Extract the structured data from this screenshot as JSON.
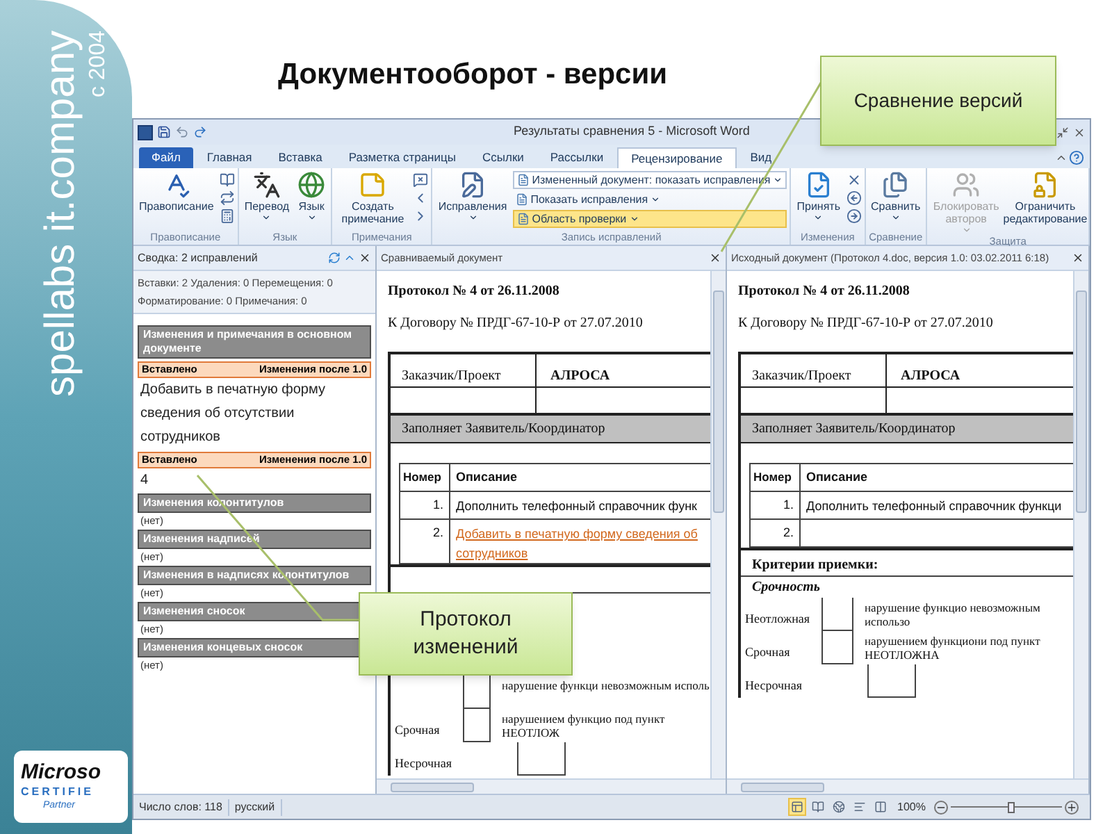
{
  "brand": {
    "name": "spellabs it.company",
    "since": "с 2004"
  },
  "partner_logo": {
    "brand": "Microso",
    "line": "CERTIFIE",
    "tier": "Partner"
  },
  "slide_title": "Документооборот - версии",
  "callouts": [
    {
      "text": "Сравнение версий"
    },
    {
      "text": "Протокол изменений"
    }
  ],
  "window": {
    "title": "Результаты сравнения 5 - Microsoft Word"
  },
  "tabs": [
    {
      "label": "Файл",
      "kind": "file",
      "selected": false
    },
    {
      "label": "Главная",
      "kind": "tab",
      "selected": false
    },
    {
      "label": "Вставка",
      "kind": "tab",
      "selected": false
    },
    {
      "label": "Разметка страницы",
      "kind": "tab",
      "selected": false
    },
    {
      "label": "Ссылки",
      "kind": "tab",
      "selected": false
    },
    {
      "label": "Рассылки",
      "kind": "tab",
      "selected": false
    },
    {
      "label": "Рецензирование",
      "kind": "tab",
      "selected": true
    },
    {
      "label": "Вид",
      "kind": "tab",
      "selected": false
    }
  ],
  "ribbon_groups": [
    {
      "label": "Правописание",
      "controls": [
        {
          "kind": "large",
          "label": "Правописание",
          "dropdown": false,
          "disabled": false
        },
        {
          "kind": "icons"
        }
      ]
    },
    {
      "label": "Язык",
      "controls": [
        {
          "kind": "large",
          "label": "Перевод",
          "dropdown": true,
          "disabled": false
        },
        {
          "kind": "large",
          "label": "Язык",
          "dropdown": true,
          "disabled": false
        }
      ]
    },
    {
      "label": "Примечания",
      "controls": [
        {
          "kind": "large",
          "label": "Создать примечание",
          "dropdown": false,
          "disabled": false
        },
        {
          "kind": "icons"
        }
      ]
    },
    {
      "label": "Запись исправлений",
      "controls": [
        {
          "kind": "large",
          "label": "Исправления",
          "dropdown": true,
          "disabled": false
        },
        {
          "kind": "rows",
          "items": [
            {
              "kind": "combo",
              "label": "Измененный документ: показать исправления",
              "selected": false
            },
            {
              "kind": "menu",
              "label": "Показать исправления",
              "selected": false
            },
            {
              "kind": "menu",
              "label": "Область проверки",
              "selected": true
            }
          ]
        }
      ]
    },
    {
      "label": "Изменения",
      "controls": [
        {
          "kind": "large",
          "label": "Принять",
          "dropdown": true,
          "disabled": false
        },
        {
          "kind": "icons"
        }
      ]
    },
    {
      "label": "Сравнение",
      "controls": [
        {
          "kind": "large",
          "label": "Сравнить",
          "dropdown": true,
          "disabled": false
        }
      ]
    },
    {
      "label": "Защита",
      "controls": [
        {
          "kind": "large",
          "label": "Блокировать авторов",
          "dropdown": true,
          "disabled": true
        },
        {
          "kind": "large",
          "label": "Ограничить редактирование",
          "dropdown": false,
          "disabled": false
        }
      ]
    }
  ],
  "review_pane": {
    "title": "Сводка: 2 исправлений",
    "summary": [
      "Вставки: 2 Удаления: 0 Перемещения: 0",
      "Форматирование: 0 Примечания: 0"
    ],
    "sections": [
      {
        "heading": "Изменения и примечания в основном документе",
        "revisions": [
          {
            "type": "Вставлено",
            "scope": "Изменения после 1.0",
            "text": "Добавить в печатную форму сведения об отсутствии сотрудников"
          },
          {
            "type": "Вставлено",
            "scope": "Изменения после 1.0",
            "text": "4"
          }
        ]
      },
      {
        "heading": "Изменения колонтитулов",
        "empty_text": "(нет)"
      },
      {
        "heading": "Изменения надписей",
        "empty_text": "(нет)"
      },
      {
        "heading": "Изменения в надписях колонтитулов",
        "empty_text": "(нет)"
      },
      {
        "heading": "Изменения сносок",
        "empty_text": "(нет)"
      },
      {
        "heading": "Изменения концевых сносок",
        "empty_text": "(нет)"
      }
    ]
  },
  "documents": [
    {
      "title": "Сравниваемый документ",
      "heading": "Протокол № 4 от 26.11.2008",
      "contract": "К Договору № ПРДГ-67-10-Р от 27.07.2010",
      "customer_label": "Заказчик/Проект",
      "customer": "АЛРОСА",
      "section": "Заполняет Заявитель/Координатор",
      "columns": [
        "Номер",
        "Описание"
      ],
      "items": [
        {
          "number": "1.",
          "text": "Дополнить телефонный справочник функ",
          "inserted": false
        },
        {
          "number": "2.",
          "text": "Добавить в печатную форму сведения об сотрудников",
          "inserted": true
        }
      ],
      "criteria_rows": [
        {
          "description": "нарушение функци невозможным исполь"
        },
        {
          "name": "Срочная",
          "description": "нарушением функцио под пункт НЕОТЛОЖ"
        },
        {
          "name": "Несрочная"
        }
      ]
    },
    {
      "title": "Исходный документ (Протокол 4.doc, версия 1.0: 03.02.2011 6:18)",
      "heading": "Протокол № 4 от 26.11.2008",
      "contract": "К Договору № ПРДГ-67-10-Р от 27.07.2010",
      "customer_label": "Заказчик/Проект",
      "customer": "АЛРОСА",
      "section": "Заполняет Заявитель/Координатор",
      "columns": [
        "Номер",
        "Описание"
      ],
      "items": [
        {
          "number": "1.",
          "text": "Дополнить телефонный справочник функци",
          "inserted": false
        },
        {
          "number": "2.",
          "inserted": false
        }
      ],
      "criteria_title": "Критерии приемки:",
      "criteria_subtitle": "Срочность",
      "criteria_rows": [
        {
          "name": "Неотложная",
          "description": "нарушение функцио невозможным использо"
        },
        {
          "name": "Срочная",
          "description": "нарушением функциони под пункт НЕОТЛОЖНА"
        },
        {
          "name": "Несрочная"
        }
      ]
    }
  ],
  "status_bar": {
    "words": "Число слов: 118",
    "language": "русский",
    "views": [
      {
        "selected": true
      },
      {
        "selected": false
      },
      {
        "selected": false
      },
      {
        "selected": false
      },
      {
        "selected": false
      }
    ],
    "zoom": "100%",
    "zoom_level": {
      "level": 0.55
    }
  }
}
